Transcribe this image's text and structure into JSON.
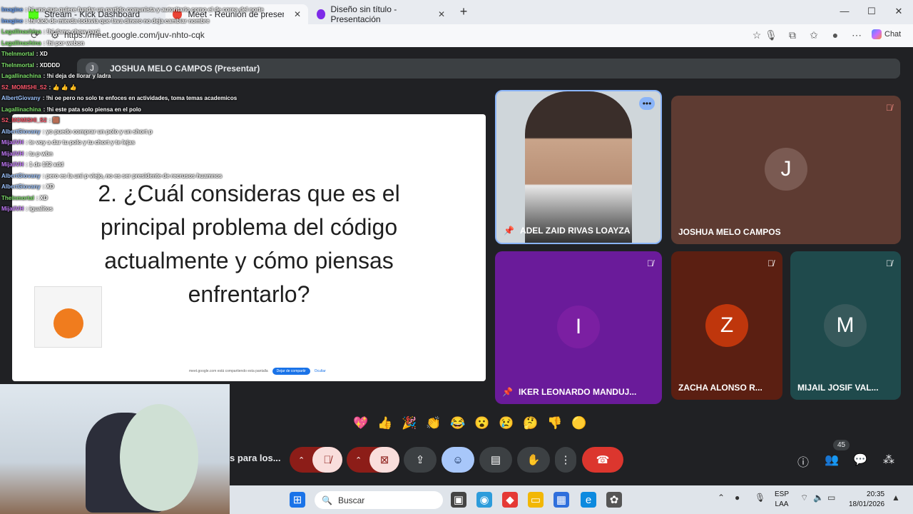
{
  "browser": {
    "tabs": [
      {
        "label": "Stream - Kick Dashboard"
      },
      {
        "label": "Meet - Reunión de presentación"
      },
      {
        "label": "Diseño sin título - Presentación"
      }
    ],
    "close_glyph": "✕",
    "new_tab_glyph": "+",
    "url": "https://meet.google.com/juv-nhto-cqk",
    "chat_label": "Chat",
    "window_controls": [
      "—",
      "☐",
      "✕"
    ]
  },
  "meet": {
    "presenter_initial": "J",
    "presenter_bar": "JOSHUA MELO CAMPOS (Presentar)",
    "slide_text": "2. ¿Cuál consideras que es el principal problema del código actualmente y cómo piensas enfrentarlo?",
    "share_bar": {
      "text": "meet.google.com está compartiendo esta pantalla",
      "stop": "Dejar de compartir",
      "hide": "Ocultar"
    },
    "participants": [
      {
        "name": "ADEL ZAID RIVAS LOAYZA",
        "initial": "",
        "color": "#cfd6da",
        "pinned": true,
        "video": true
      },
      {
        "name": "JOSHUA MELO CAMPOS",
        "initial": "J",
        "color": "#5e3b32",
        "avatar_color": "#7a5a52"
      },
      {
        "name": "IKER LEONARDO MANDUJ...",
        "initial": "I",
        "color": "#6a1b9a",
        "avatar_color": "#7b1fa2",
        "pinned": true
      },
      {
        "name": "ZACHA ALONSO R...",
        "initial": "Z",
        "color": "#5b1f12",
        "avatar_color": "#bf360c"
      },
      {
        "name": "MIJAIL JOSIF VAL...",
        "initial": "M",
        "color": "#1f4a4c",
        "avatar_color": "#37595b"
      }
    ],
    "reactions": [
      "💖",
      "👍",
      "🎉",
      "👏",
      "😂",
      "😮",
      "😢",
      "🤔",
      "👎",
      "🟡"
    ],
    "caption_text": "s para los...",
    "participant_count": "45"
  },
  "taskbar": {
    "search_placeholder": "Buscar",
    "lang": [
      "ESP",
      "LAA"
    ],
    "time": "20:35",
    "date": "18/01/2026"
  },
  "chat_overlay": [
    {
      "user": "Imagine",
      "text": ": hi uno que quiere fundar un partido comunista y autoritario como el de corea del norte",
      "color": "#6fa8ff"
    },
    {
      "user": "Imagine",
      "text": ": !hi kick de mierda todavía que lava dinero no deja cambiar nombre",
      "color": "#6fa8ff"
    },
    {
      "user": "Lagallinachina",
      "text": ": !hi dame chow papi",
      "color": "#7ee06a"
    },
    {
      "user": "Lagallinachina",
      "text": ": !hi por webon",
      "color": "#7ee06a"
    },
    {
      "user": "TheInmortal",
      "text": ": XD",
      "color": "#7ee06a"
    },
    {
      "user": "TheInmortal",
      "text": ": XDDDD",
      "color": "#7ee06a"
    },
    {
      "user": "Lagallinachina",
      "text": ": !hi deja de llorar y ladra",
      "color": "#7ee06a"
    },
    {
      "user": "S2_MOMISHI_S2",
      "text": ": 👍 👍 👍",
      "color": "#ff5a6e"
    },
    {
      "user": "AlbertGiovany",
      "text": ": !hi oe pero no solo te enfoces en actividades, toma temas academicos",
      "color": "#9ec5ff"
    },
    {
      "user": "Lagallinachina",
      "text": ": !hi este pata solo piensa en el polo",
      "color": "#7ee06a"
    },
    {
      "user": "S2_MOMISHI_S2",
      "text": ": 🟫",
      "color": "#ff5a6e"
    },
    {
      "user": "AlbertGiovany",
      "text": ": yo puedo comprar un polo y un short p",
      "color": "#9ec5ff"
    },
    {
      "user": "MijailVH",
      "text": ": te voy a dar tu polo y tu chort y te lejas",
      "color": "#c77dff"
    },
    {
      "user": "MijailVH",
      "text": ": tu p wbn",
      "color": "#c77dff"
    },
    {
      "user": "MijailVH",
      "text": ": 1 de 132 xdd",
      "color": "#c77dff"
    },
    {
      "user": "AlbertGiovany",
      "text": ": pero es la uni p viejo, no es ser presidente de recrusos huamnos",
      "color": "#9ec5ff"
    },
    {
      "user": "AlbertGiovany",
      "text": ": XD",
      "color": "#9ec5ff"
    },
    {
      "user": "TheInmortal",
      "text": ": XD",
      "color": "#7ee06a"
    },
    {
      "user": "MijailVH",
      "text": ": igualitos",
      "color": "#c77dff"
    }
  ]
}
